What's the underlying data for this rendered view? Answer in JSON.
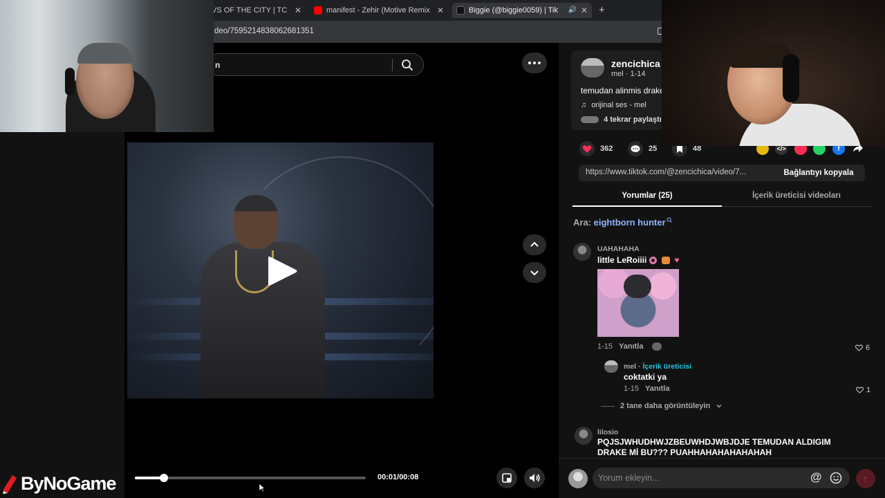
{
  "browser": {
    "tabs": [
      {
        "label": "VS OF THE CITY | TCF -",
        "active": false
      },
      {
        "label": "manifest - Zehir (Motive Remix)",
        "active": false
      },
      {
        "label": "Biggie (@biggie0059) | TikT",
        "active": true
      }
    ],
    "new_tab": "+",
    "close": "✕",
    "url": "deo/7595214838062681351"
  },
  "search": {
    "value": "n"
  },
  "player": {
    "progress_fraction": 0.125,
    "time": "00:01/00:08"
  },
  "post": {
    "username": "zencichica",
    "meta": "mel · 1-14",
    "description": "temudan alinmis drake",
    "music": "orijinal ses - mel",
    "music_icon": "♫",
    "reposts": "4 tekrar paylaştı",
    "likes": "362",
    "comments": "25",
    "saves": "48",
    "share_colors": [
      "#e8b90d",
      "#333333",
      "#fe2c55",
      "#25d366",
      "#1877f2"
    ]
  },
  "link": {
    "url": "https://www.tiktok.com/@zencichica/video/7...",
    "copy_label": "Bağlantıyı kopyala"
  },
  "tabs": {
    "comments": "Yorumlar (25)",
    "creator_videos": "İçerik üreticisi videoları"
  },
  "search_suggestion": {
    "prefix": "Ara:",
    "keyword": "eightborn hunter"
  },
  "comments": [
    {
      "user": "UAHAHAHA",
      "text": "little LeRoiiii",
      "date": "1-15",
      "reply_label": "Yanıtla",
      "likes": "6"
    },
    {
      "user": "mel",
      "creator_label": "İçerik üreticisi",
      "text": "coktatki ya",
      "date": "1-15",
      "reply_label": "Yanıtla",
      "likes": "1"
    },
    {
      "user": "lilosio",
      "text": "PQJSJWHUDHWJZBEUWHDJWBJDJE TEMUDAN ALDIGIM DRAKE Mİ BU??? PUAHHAHAHAHAHAHAH"
    }
  ],
  "view_more": "2 tane daha görüntüleyin",
  "comment_input": {
    "placeholder": "Yorum ekleyin..."
  },
  "brand": "ByNoGame"
}
